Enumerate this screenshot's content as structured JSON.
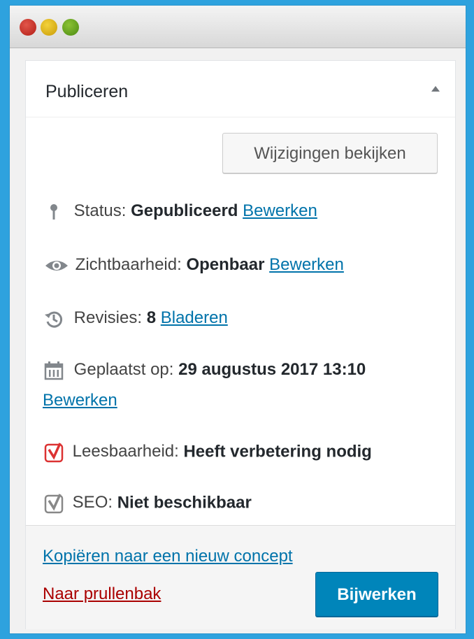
{
  "box": {
    "title": "Publiceren",
    "preview_label": "Wijzigingen bekijken"
  },
  "status": {
    "label": "Status:",
    "value": "Gepubliceerd",
    "edit": "Bewerken"
  },
  "visibility": {
    "label": "Zichtbaarheid:",
    "value": "Openbaar",
    "edit": "Bewerken"
  },
  "revisions": {
    "label": "Revisies:",
    "value": "8",
    "browse": "Bladeren"
  },
  "published": {
    "label": "Geplaatst op:",
    "value": "29 augustus 2017 13:10",
    "edit": "Bewerken"
  },
  "readability": {
    "label": "Leesbaarheid:",
    "value": "Heeft verbetering nodig"
  },
  "seo": {
    "label": "SEO:",
    "value": "Niet beschikbaar"
  },
  "actions": {
    "copy_label": "Kopiëren naar een nieuw concept",
    "trash_label": "Naar prullenbak",
    "update_label": "Bijwerken"
  },
  "colors": {
    "background": "#2ea2de",
    "link": "#0073aa",
    "delete": "#aa0000",
    "primary_button": "#0085ba",
    "readability_bad": "#dc3232"
  },
  "icons": [
    "pin-icon",
    "eye-icon",
    "history-icon",
    "calendar-icon",
    "yoast-readability-icon",
    "yoast-seo-icon",
    "collapse-arrow-icon"
  ]
}
